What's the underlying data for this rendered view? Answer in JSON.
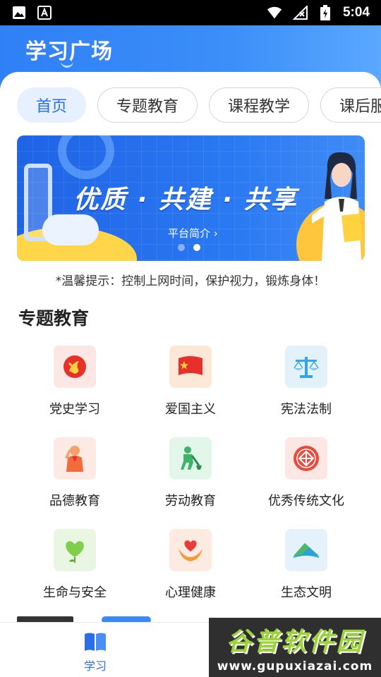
{
  "status_bar": {
    "time": "5:04"
  },
  "header": {
    "title": "学习广场"
  },
  "tabs": [
    {
      "label": "首页",
      "active": true
    },
    {
      "label": "专题教育",
      "active": false
    },
    {
      "label": "课程教学",
      "active": false
    },
    {
      "label": "课后服",
      "active": false
    }
  ],
  "banner": {
    "slogan": "优质 · 共建 · 共享",
    "link": "平台简介",
    "slide_count": 2,
    "active_slide": 1,
    "colors": {
      "bg": "#2a78f2",
      "accent": "#ffc53d"
    }
  },
  "tip": "*温馨提示：控制上网时间，保护视力，锻炼身体！",
  "section": {
    "title": "专题教育"
  },
  "topics": [
    {
      "label": "党史学习",
      "icon": "party-emblem-icon",
      "bg": "#fde7e5"
    },
    {
      "label": "爱国主义",
      "icon": "flag-icon",
      "bg": "#fde7d6"
    },
    {
      "label": "宪法法制",
      "icon": "scales-icon",
      "bg": "#e3f1fb"
    },
    {
      "label": "品德教育",
      "icon": "young-pioneer-icon",
      "bg": "#fdeae4"
    },
    {
      "label": "劳动教育",
      "icon": "labor-icon",
      "bg": "#e3f6ea"
    },
    {
      "label": "优秀传统文化",
      "icon": "chinese-knot-icon",
      "bg": "#fde7e4"
    },
    {
      "label": "生命与安全",
      "icon": "heart-leaf-icon",
      "bg": "#e8f6e2"
    },
    {
      "label": "心理健康",
      "icon": "heart-hands-icon",
      "bg": "#fdeae0"
    },
    {
      "label": "生态文明",
      "icon": "eco-mountain-icon",
      "bg": "#e6f2fb"
    }
  ],
  "bottom_nav": {
    "study_label": "学习"
  },
  "watermark": {
    "big": "谷普软件园",
    "small": "www.gupuxiazai.com"
  }
}
